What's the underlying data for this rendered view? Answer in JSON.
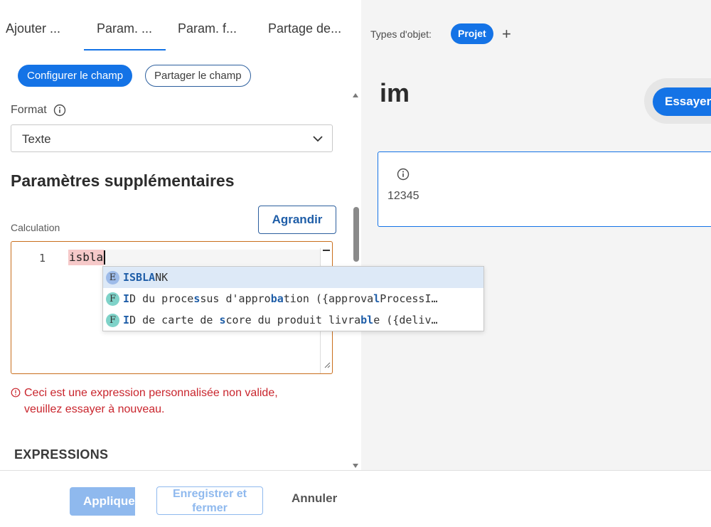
{
  "tabs": [
    {
      "label": "Ajouter ..."
    },
    {
      "label": "Param. ..."
    },
    {
      "label": "Param. f..."
    },
    {
      "label": "Partage de..."
    }
  ],
  "actions": {
    "configure_label": "Configurer le champ",
    "share_label": "Partager le champ"
  },
  "format": {
    "label": "Format",
    "value": "Texte"
  },
  "section_title": "Paramètres supplémentaires",
  "calculation": {
    "label": "Calculation",
    "expand_label": "Agrandir",
    "line_number": "1",
    "code": "isbla"
  },
  "autocomplete": {
    "items": [
      {
        "badge": "E",
        "kind": "expression",
        "selected": true,
        "parts": [
          {
            "t": "ISBLA",
            "m": true
          },
          {
            "t": "NK",
            "m": false
          }
        ]
      },
      {
        "badge": "F",
        "kind": "field",
        "selected": false,
        "parts": [
          {
            "t": "I",
            "m": true
          },
          {
            "t": "D du proce",
            "m": false
          },
          {
            "t": "s",
            "m": true
          },
          {
            "t": "sus d'appro",
            "m": false
          },
          {
            "t": "ba",
            "m": true
          },
          {
            "t": "tion ({approva",
            "m": false
          },
          {
            "t": "l",
            "m": true
          },
          {
            "t": "ProcessI…",
            "m": false
          }
        ]
      },
      {
        "badge": "F",
        "kind": "field",
        "selected": false,
        "parts": [
          {
            "t": "I",
            "m": true
          },
          {
            "t": "D de carte de ",
            "m": false
          },
          {
            "t": "s",
            "m": true
          },
          {
            "t": "core du produit livra",
            "m": false
          },
          {
            "t": "bl",
            "m": true
          },
          {
            "t": "e ({deliv…",
            "m": false
          }
        ]
      }
    ]
  },
  "error_message": "Ceci est une expression personnalisée non valide, veuillez essayer à nouveau.",
  "expressions_title": "EXPRESSIONS",
  "preview": {
    "types_label": "Types d'objet:",
    "object_type_chip": "Projet",
    "add_icon": "plus-icon",
    "title": "im",
    "try_label": "Essayer",
    "field_value": "12345"
  },
  "footer": {
    "apply_label": "Appliquer",
    "save_close_label": "Enregistrer et fermer",
    "cancel_label": "Annuler"
  },
  "colors": {
    "accent": "#1473e6",
    "error": "#c9252d",
    "editor_error_border": "#c96e1c",
    "disabled_accent": "#8fb9ee"
  }
}
